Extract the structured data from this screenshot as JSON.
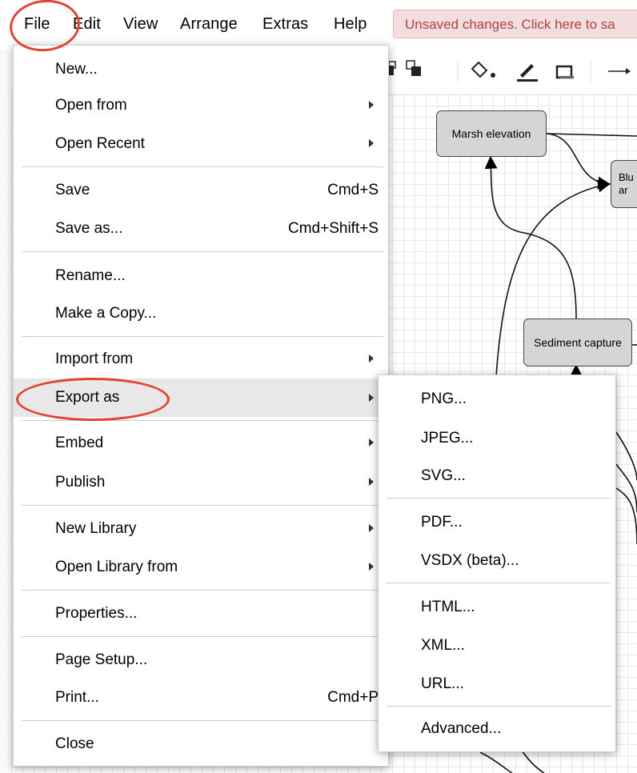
{
  "menubar": {
    "items": [
      "File",
      "Edit",
      "View",
      "Arrange",
      "Extras",
      "Help"
    ],
    "unsaved_notice": "Unsaved changes. Click here to sa"
  },
  "diagram": {
    "nodes": [
      "Marsh elevation",
      "Blu\nar",
      "Sediment capture"
    ]
  },
  "file_menu": {
    "items": [
      {
        "label": "New..."
      },
      {
        "label": "Open from",
        "submenu": true
      },
      {
        "label": "Open Recent",
        "submenu": true
      },
      {
        "label": "Save",
        "shortcut": "Cmd+S"
      },
      {
        "label": "Save as...",
        "shortcut": "Cmd+Shift+S"
      },
      {
        "label": "Rename..."
      },
      {
        "label": "Make a Copy..."
      },
      {
        "label": "Import from",
        "submenu": true
      },
      {
        "label": "Export as",
        "submenu": true,
        "highlighted": true
      },
      {
        "label": "Embed",
        "submenu": true
      },
      {
        "label": "Publish",
        "submenu": true
      },
      {
        "label": "New Library",
        "submenu": true
      },
      {
        "label": "Open Library from",
        "submenu": true
      },
      {
        "label": "Properties..."
      },
      {
        "label": "Page Setup..."
      },
      {
        "label": "Print...",
        "shortcut": "Cmd+P"
      },
      {
        "label": "Close"
      }
    ]
  },
  "export_submenu": {
    "items": [
      "PNG...",
      "JPEG...",
      "SVG...",
      "PDF...",
      "VSDX (beta)...",
      "HTML...",
      "XML...",
      "URL...",
      "Advanced..."
    ]
  },
  "colors": {
    "annotation_ring": "#e0452f",
    "highlight": "#e8e8e8",
    "unsaved_bg": "#f2dede",
    "unsaved_text": "#b0413e"
  }
}
